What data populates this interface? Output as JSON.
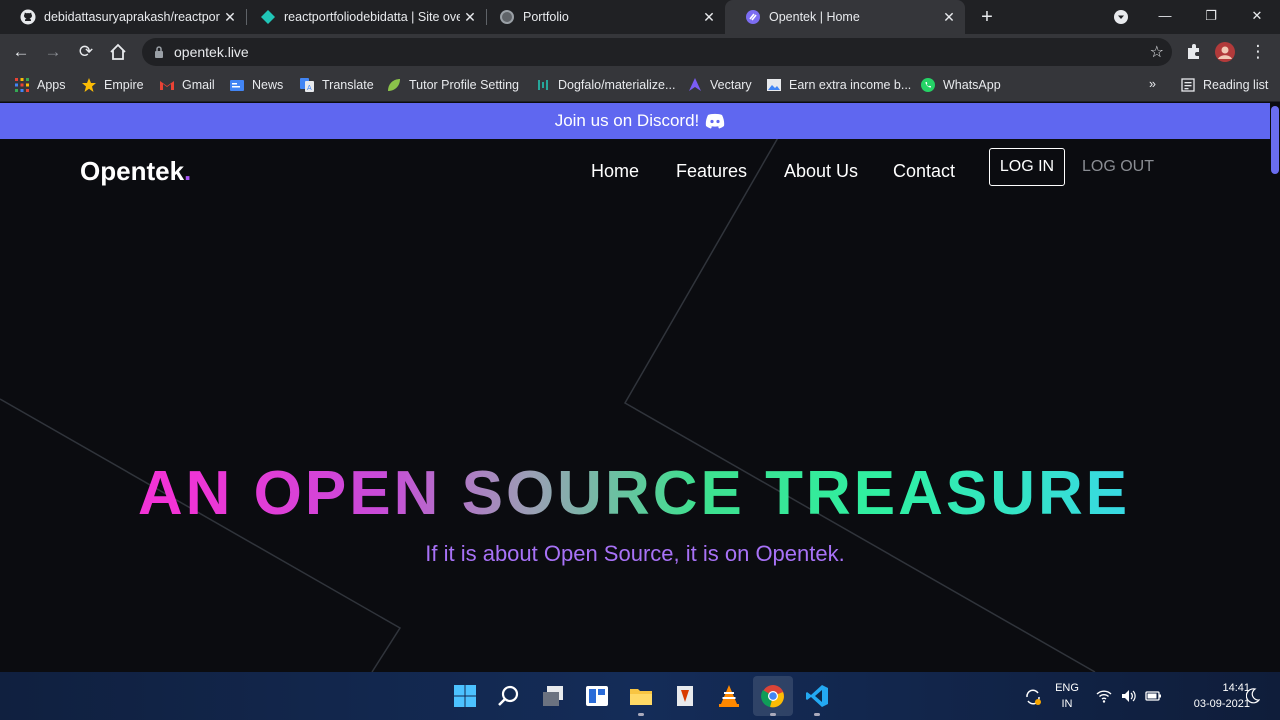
{
  "browser": {
    "tabs": [
      {
        "title": "debidattasuryaprakash/reactport",
        "icon": "github-icon"
      },
      {
        "title": "reactportfoliodebidatta | Site ove",
        "icon": "netlify-icon"
      },
      {
        "title": "Portfolio",
        "icon": "globe-icon"
      },
      {
        "title": "Opentek | Home",
        "icon": "opentek-icon",
        "active": true
      }
    ],
    "url": "opentek.live",
    "bookmarks": [
      {
        "label": "Apps",
        "icon": "apps-grid-icon"
      },
      {
        "label": "Empire",
        "icon": "star-icon"
      },
      {
        "label": "Gmail",
        "icon": "gmail-icon"
      },
      {
        "label": "News",
        "icon": "google-news-icon"
      },
      {
        "label": "Translate",
        "icon": "translate-icon"
      },
      {
        "label": "Tutor Profile Setting",
        "icon": "leaf-icon"
      },
      {
        "label": "Dogfalo/materialize...",
        "icon": "materialize-icon"
      },
      {
        "label": "Vectary",
        "icon": "vectary-icon"
      },
      {
        "label": "Earn extra income b...",
        "icon": "image-icon"
      },
      {
        "label": "WhatsApp",
        "icon": "whatsapp-icon"
      }
    ],
    "reading_list": "Reading list",
    "more_bookmarks": "»"
  },
  "site": {
    "banner": "Join us on Discord!",
    "logo": "Opentek",
    "logo_dot": ".",
    "nav": [
      "Home",
      "Features",
      "About Us",
      "Contact"
    ],
    "login": "LOG IN",
    "logout": "LOG OUT",
    "hero_title": "AN OPEN SOURCE TREASURE",
    "hero_subtitle": "If it is about Open Source, it is on Opentek."
  },
  "taskbar": {
    "lang_top": "ENG",
    "lang_bottom": "IN",
    "time": "14:41",
    "date": "03-09-2021"
  },
  "colors": {
    "banner": "#5f67f0",
    "page_bg": "#0b0c10",
    "subtitle": "#a872f7",
    "gradient_start": "#f233d6",
    "gradient_end": "#39d8e8"
  }
}
